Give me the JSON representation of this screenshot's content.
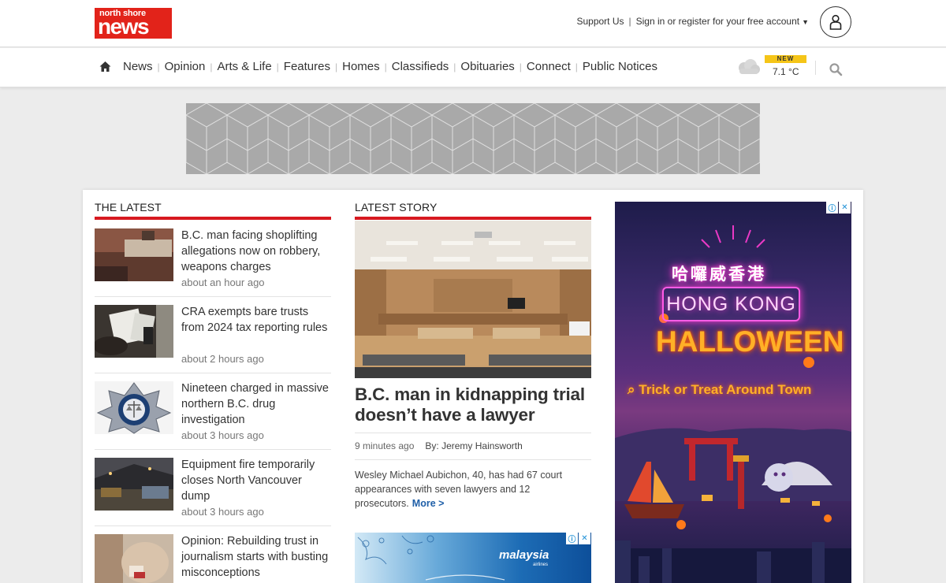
{
  "header": {
    "logo_line1": "north shore",
    "logo_line2": "news",
    "support_label": "Support Us",
    "signin_label": "Sign in or register for your free account"
  },
  "nav": {
    "items": [
      "News",
      "Opinion",
      "Arts & Life",
      "Features",
      "Homes",
      "Classifieds",
      "Obituaries",
      "Connect",
      "Public Notices"
    ],
    "weather_badge": "NEW",
    "temperature": "7.1 °C"
  },
  "latest": {
    "title": "THE LATEST",
    "stories": [
      {
        "headline": "B.C. man facing shoplifting allegations now on robbery, weapons charges",
        "time": "about an hour ago"
      },
      {
        "headline": "CRA exempts bare trusts from 2024 tax reporting rules",
        "time": "about 2 hours ago"
      },
      {
        "headline": "Nineteen charged in massive northern B.C. drug investigation",
        "time": "about 3 hours ago"
      },
      {
        "headline": "Equipment fire temporarily closes North Vancouver dump",
        "time": "about 3 hours ago"
      },
      {
        "headline": "Opinion: Rebuilding trust in journalism starts with busting misconceptions",
        "time": ""
      }
    ]
  },
  "feature": {
    "section_title": "LATEST STORY",
    "headline": "B.C. man in kidnapping trial doesn’t have a lawyer",
    "time": "9 minutes ago",
    "byline": "By: Jeremy Hainsworth",
    "summary": "Wesley Michael Aubichon, 40, has had 67 court appearances with seven lawyers and 12 prosecutors.",
    "more_label": "More >"
  },
  "ads": {
    "mini_brand": "malaysia",
    "mini_brand_sub": "airlines",
    "side_cjk": "哈囉威香港",
    "side_hk": "HONG KONG",
    "side_halloween": "HALLOWEEN",
    "side_tagline": "Trick or Treat Around Town"
  },
  "colors": {
    "brand_red": "#e2231a",
    "section_rule": "#d71920",
    "link_blue": "#1f5fa8",
    "badge_yellow": "#f5c518"
  },
  "icons": [
    "home-icon",
    "user-icon",
    "cloud-icon",
    "search-icon",
    "adchoices-icon",
    "close-icon",
    "caret-down-icon"
  ]
}
